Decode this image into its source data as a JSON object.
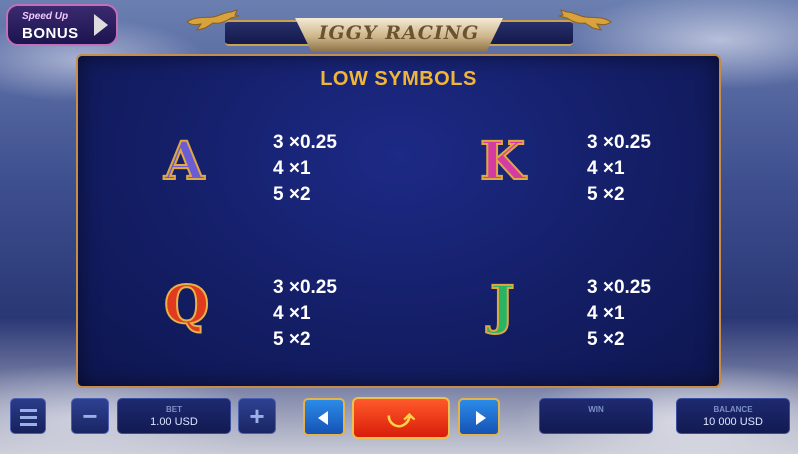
{
  "bonus_button": {
    "top_label": "Speed Up",
    "main_label": "BONUS"
  },
  "header": {
    "title": "IGGY RACING"
  },
  "paytable": {
    "title": "LOW SYMBOLS",
    "symbols": [
      {
        "glyph": "A",
        "pays": [
          "3 ×0.25",
          "4 ×1",
          "5 ×2"
        ]
      },
      {
        "glyph": "K",
        "pays": [
          "3 ×0.25",
          "4 ×1",
          "5 ×2"
        ]
      },
      {
        "glyph": "Q",
        "pays": [
          "3 ×0.25",
          "4 ×1",
          "5 ×2"
        ]
      },
      {
        "glyph": "J",
        "pays": [
          "3 ×0.25",
          "4 ×1",
          "5 ×2"
        ]
      }
    ]
  },
  "controls": {
    "menu_icon": "hamburger-icon",
    "minus_label": "−",
    "plus_label": "+",
    "bet": {
      "label": "BET",
      "value": "1.00 USD"
    },
    "spin_icon": "spin-icon",
    "spin_glyph": "⤻",
    "win": {
      "label": "WIN",
      "value": ""
    },
    "balance": {
      "label": "BALANCE",
      "value": "10 000 USD"
    }
  }
}
